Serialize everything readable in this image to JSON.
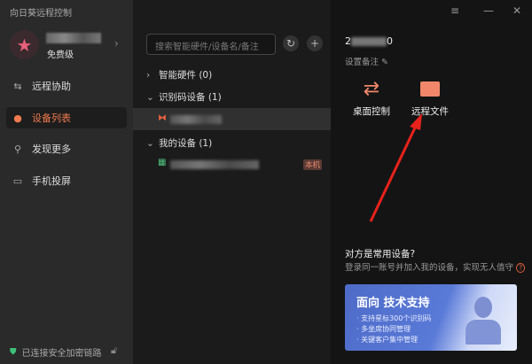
{
  "app": {
    "title": "向日葵远程控制"
  },
  "user": {
    "tier": "免费级"
  },
  "nav": [
    {
      "label": "远程协助",
      "icon": "remote-assist-icon"
    },
    {
      "label": "设备列表",
      "icon": "device-list-icon",
      "active": true
    },
    {
      "label": "发现更多",
      "icon": "discover-icon"
    },
    {
      "label": "手机投屏",
      "icon": "screen-cast-icon"
    }
  ],
  "status": {
    "secure": "已连接安全加密链路"
  },
  "device_panel": {
    "search_placeholder": "搜索智能硬件/设备名/备注",
    "groups": [
      {
        "label": "智能硬件 (0)",
        "expanded": false
      },
      {
        "label": "识别码设备 (1)",
        "expanded": true
      },
      {
        "label": "我的设备 (1)",
        "expanded": true
      }
    ],
    "local_tag": "本机"
  },
  "detail": {
    "device_id_start": "2",
    "device_id_end": "0",
    "set_note": "设置备注",
    "actions": [
      {
        "label": "桌面控制",
        "icon": "desktop-control-icon"
      },
      {
        "label": "远程文件",
        "icon": "folder-icon"
      }
    ],
    "question": "对方是常用设备?",
    "hint": "登录同一账号并加入我的设备，实现无人值守",
    "banner": {
      "title": "面向 技术支持",
      "bullets": [
        "· 支持星标300个识别码",
        "· 多坐席协同管理",
        "· 关键客户集中管理"
      ]
    }
  },
  "colors": {
    "accent": "#f07a4f",
    "arrow": "#e8221b"
  }
}
